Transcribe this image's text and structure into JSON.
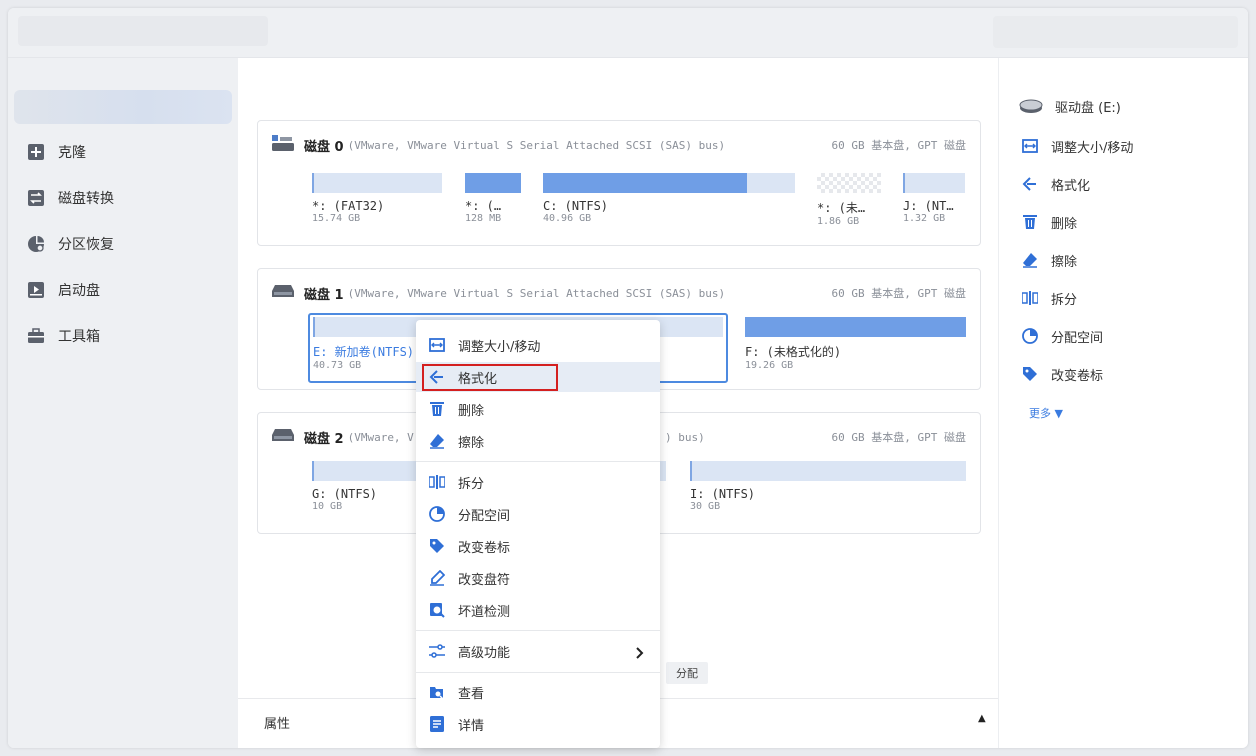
{
  "sidebar": {
    "items": [
      {
        "label": "克隆",
        "icon": "clone-icon"
      },
      {
        "label": "磁盘转换",
        "icon": "disk-convert-icon"
      },
      {
        "label": "分区恢复",
        "icon": "partition-recovery-icon"
      },
      {
        "label": "启动盘",
        "icon": "bootable-media-icon"
      },
      {
        "label": "工具箱",
        "icon": "toolbox-icon"
      }
    ]
  },
  "disks": [
    {
      "name": "磁盘 0",
      "bus": "(VMware,  VMware Virtual S Serial Attached SCSI (SAS) bus)",
      "size": "60 GB 基本盘, GPT 磁盘",
      "partitions": [
        {
          "label": "*: (FAT32)",
          "size": "15.74 GB",
          "used_fraction": 0.0
        },
        {
          "label": "*: (…",
          "size": "128 MB",
          "used_fraction": 1.0
        },
        {
          "label": "C: (NTFS)",
          "size": "40.96 GB",
          "used_fraction": 0.81
        },
        {
          "label": "*: (未…",
          "size": "1.86 GB",
          "used_fraction": 0.0
        },
        {
          "label": "J: (NT…",
          "size": "1.32 GB",
          "used_fraction": 0.0
        }
      ]
    },
    {
      "name": "磁盘 1",
      "bus": "(VMware,  VMware Virtual S Serial Attached SCSI (SAS) bus)",
      "size": "60 GB 基本盘, GPT 磁盘",
      "partitions": [
        {
          "label": "E: 新加卷(NTFS)",
          "size": "40.73 GB",
          "used_fraction": 0.0
        },
        {
          "label": "F: (未格式化的)",
          "size": "19.26 GB",
          "used_fraction": 1.0
        }
      ]
    },
    {
      "name": "磁盘 2",
      "bus": "(VMware,  V",
      "bus_tail": ") bus)",
      "size": "60 GB 基本盘, GPT 磁盘",
      "partitions": [
        {
          "label": "G: (NTFS)",
          "size": "10 GB",
          "used_fraction": 0.0
        },
        {
          "label": "I: (NTFS)",
          "size": "30 GB",
          "used_fraction": 0.0
        }
      ]
    }
  ],
  "main": {
    "alloc_button": "分配",
    "properties_title": "属性"
  },
  "right_panel": {
    "drive_label": "驱动盘 (E:)",
    "actions": [
      {
        "label": "调整大小/移动",
        "icon": "resize-move-icon"
      },
      {
        "label": "格式化",
        "icon": "format-icon"
      },
      {
        "label": "删除",
        "icon": "delete-icon"
      },
      {
        "label": "擦除",
        "icon": "wipe-icon"
      },
      {
        "label": "拆分",
        "icon": "split-icon"
      },
      {
        "label": "分配空间",
        "icon": "allocate-space-icon"
      },
      {
        "label": "改变卷标",
        "icon": "change-label-icon"
      }
    ],
    "more": "更多 ▼"
  },
  "context_menu": {
    "items": [
      {
        "label": "调整大小/移动",
        "icon": "resize-move-icon"
      },
      {
        "label": "格式化",
        "icon": "format-icon"
      },
      {
        "label": "删除",
        "icon": "delete-icon"
      },
      {
        "label": "擦除",
        "icon": "wipe-icon"
      },
      {
        "label": "拆分",
        "icon": "split-icon"
      },
      {
        "label": "分配空间",
        "icon": "allocate-space-icon"
      },
      {
        "label": "改变卷标",
        "icon": "change-label-icon"
      },
      {
        "label": "改变盘符",
        "icon": "change-drive-letter-icon"
      },
      {
        "label": "坏道检测",
        "icon": "bad-sector-check-icon"
      },
      {
        "label": "高级功能",
        "icon": "advanced-icon"
      },
      {
        "label": "查看",
        "icon": "explore-icon"
      },
      {
        "label": "详情",
        "icon": "details-icon"
      }
    ],
    "highlighted": "格式化"
  },
  "colors": {
    "accent": "#3a7be0",
    "partition_fill": "#6f9ee6",
    "highlight_box": "#d42020"
  }
}
